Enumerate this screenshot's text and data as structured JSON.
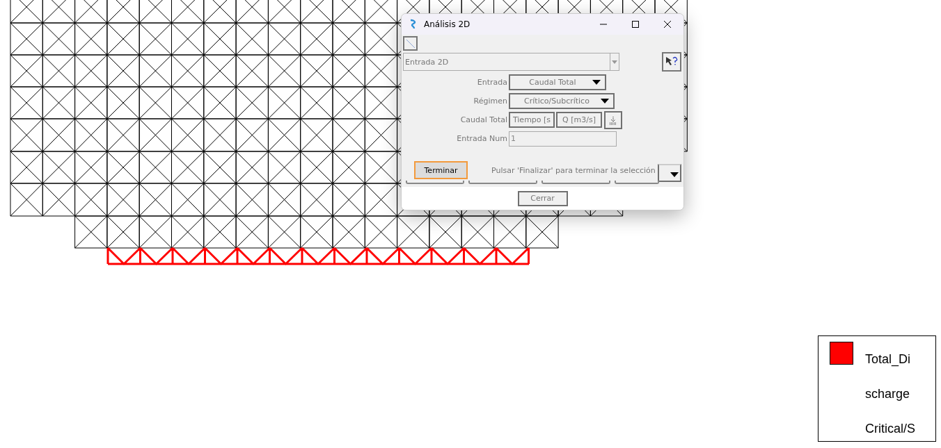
{
  "dialog": {
    "title": "Análisis 2D",
    "mode_select": {
      "value": "Entrada 2D"
    },
    "fields": [
      {
        "label": "Entrada",
        "kind": "dropdown",
        "value": "Caudal Total"
      },
      {
        "label": "Régimen",
        "kind": "dropdown",
        "value": "Crítico/Subcrítico"
      },
      {
        "label": "Caudal Total",
        "kind": "table",
        "columns": [
          "Tiempo [s",
          "Q [m3/s]"
        ]
      },
      {
        "label": "Entrada Num",
        "kind": "text",
        "value": "1"
      }
    ],
    "finish_button": "Terminar",
    "prompt": "Pulsar 'Finalizar' para terminar la selección",
    "close_button": "Cerrar"
  },
  "legend": {
    "items": [
      {
        "label_lines": [
          "Total_Di",
          "scharge",
          "Critical/S"
        ],
        "color": "#ff0000"
      }
    ]
  }
}
